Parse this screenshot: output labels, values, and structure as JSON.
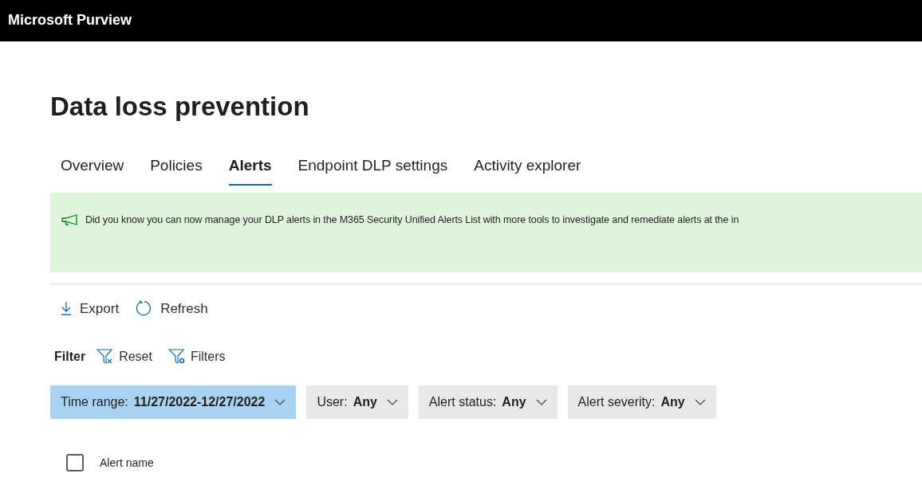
{
  "header": {
    "title": "Microsoft Purview"
  },
  "page": {
    "title": "Data loss prevention"
  },
  "tabs": [
    {
      "label": "Overview",
      "selected": false
    },
    {
      "label": "Policies",
      "selected": false
    },
    {
      "label": "Alerts",
      "selected": true
    },
    {
      "label": "Endpoint DLP settings",
      "selected": false
    },
    {
      "label": "Activity explorer",
      "selected": false
    }
  ],
  "banner": {
    "text": "Did you know you can now manage your DLP alerts in the M365 Security Unified Alerts List with more tools to investigate and remediate alerts at the in"
  },
  "toolbar": [
    {
      "kind": "export",
      "label": "Export"
    },
    {
      "kind": "refresh",
      "label": "Refresh"
    }
  ],
  "filter": {
    "label": "Filter",
    "actions": [
      {
        "kind": "reset",
        "label": "Reset"
      },
      {
        "kind": "filters",
        "label": "Filters"
      }
    ]
  },
  "pills": [
    {
      "label": "Time range:",
      "value": "11/27/2022-12/27/2022",
      "selected": true
    },
    {
      "label": "User:",
      "value": "Any",
      "selected": false
    },
    {
      "label": "Alert status:",
      "value": "Any",
      "selected": false
    },
    {
      "label": "Alert severity:",
      "value": "Any",
      "selected": false
    }
  ],
  "table": {
    "select_all": {
      "checked": false
    },
    "columns": [
      "Alert name"
    ]
  }
}
